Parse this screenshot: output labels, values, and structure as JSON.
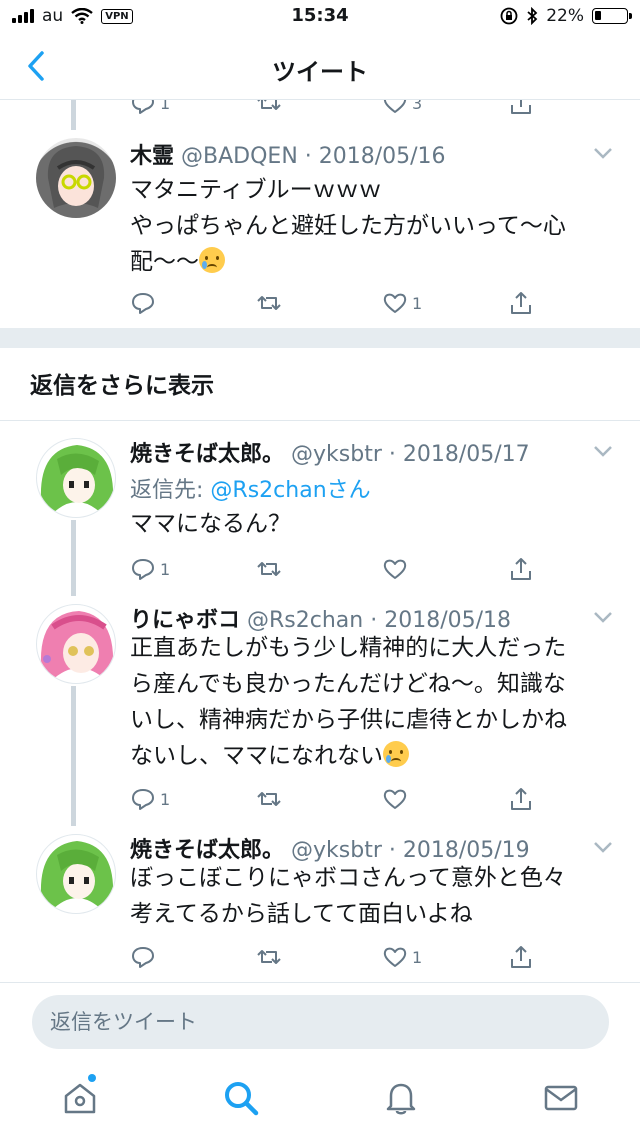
{
  "status_bar": {
    "carrier": "au",
    "vpn": "VPN",
    "time": "15:34",
    "battery": "22%",
    "battery_level": 0.22
  },
  "nav": {
    "title": "ツイート"
  },
  "partial_actions": {
    "reply_count": "1",
    "like_count": "3"
  },
  "tweets": [
    {
      "name": "木霊",
      "meta": "@BADQEN · 2018/05/16",
      "lines": [
        "マタニティブルーｗｗｗ",
        "やっぱちゃんと避妊した方がいいって〜心",
        "配〜〜"
      ],
      "reply_count": "",
      "like_count": "1"
    },
    {
      "name": "焼きそば太郎。",
      "meta": "@yksbtr · 2018/05/17",
      "reply_to_label": "返信先:",
      "reply_to_handle": "@Rs2chanさん",
      "lines": [
        "ママになるん？"
      ],
      "reply_count": "1",
      "like_count": ""
    },
    {
      "name": "りにゃボコ",
      "meta": "@Rs2chan · 2018/05/18",
      "lines": [
        "正直あたしがもう少し精神的に大人だった",
        "ら産んでも良かったんだけどね〜。知識な",
        "いし、精神病だから子供に虐待とかしかね",
        "ないし、ママになれない"
      ],
      "reply_count": "1",
      "like_count": ""
    },
    {
      "name": "焼きそば太郎。",
      "meta": "@yksbtr · 2018/05/19",
      "lines": [
        "ぼっこぼこりにゃボコさんって意外と色々",
        "考えてるから話してて面白いよね"
      ],
      "reply_count": "",
      "like_count": "1"
    }
  ],
  "more_replies_label": "返信をさらに表示",
  "reply_bar": {
    "placeholder": "返信をツイート"
  },
  "colors": {
    "accent": "#1da1f2",
    "muted": "#657786",
    "divider": "#e6ecf0"
  }
}
